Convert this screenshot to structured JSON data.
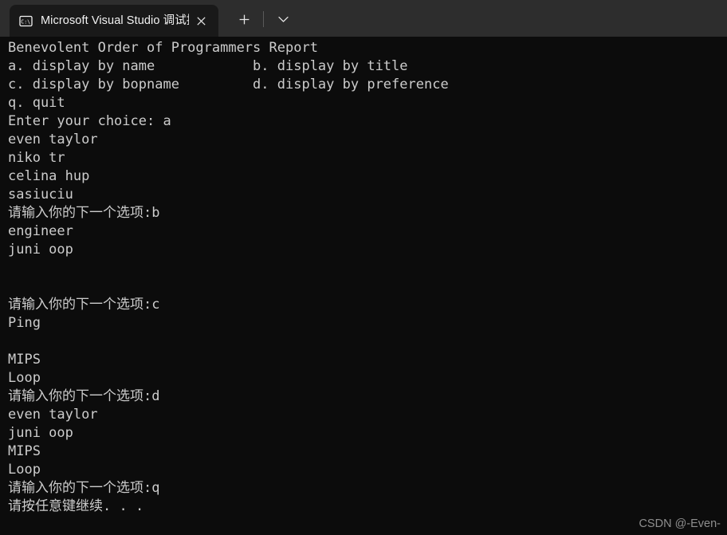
{
  "window": {
    "background_color": "#0c0c0c",
    "titlebar_color": "#2d2d2d",
    "active_tab_color": "#191919",
    "text_color": "#cccccc"
  },
  "titlebar": {
    "tab": {
      "icon_name": "command-prompt-icon",
      "icon_label": "C:\\",
      "title": "Microsoft Visual Studio 调试控",
      "close_label": "✕"
    },
    "new_tab_label": "+",
    "dropdown_label": "⌄"
  },
  "console": {
    "lines": [
      "Benevolent Order of Programmers Report",
      "a. display by name            b. display by title",
      "c. display by bopname         d. display by preference",
      "q. quit",
      "Enter your choice: a",
      "even taylor",
      "niko tr",
      "celina hup",
      "sasiuciu",
      "请输入你的下一个选项:b",
      "engineer",
      "juni oop",
      "",
      "",
      "请输入你的下一个选项:c",
      "Ping",
      "",
      "MIPS",
      "Loop",
      "请输入你的下一个选项:d",
      "even taylor",
      "juni oop",
      "MIPS",
      "Loop",
      "请输入你的下一个选项:q",
      "请按任意键继续. . ."
    ]
  },
  "watermark": {
    "text": "CSDN @-Even-"
  }
}
